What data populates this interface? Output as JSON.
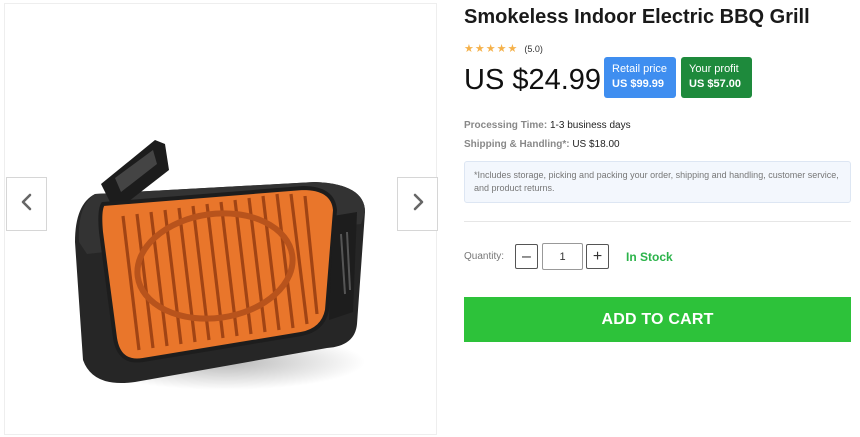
{
  "gallery": {
    "prev_icon": "chevron-left-icon",
    "next_icon": "chevron-right-icon",
    "image_alt": "Smokeless Indoor Electric BBQ Grill product image"
  },
  "product": {
    "title": "Smokeless Indoor Electric BBQ Grill",
    "rating_stars": 5,
    "rating_text": "(5.0)",
    "price": "US $24.99"
  },
  "badges": {
    "retail_label": "Retail price",
    "retail_value": "US $99.99",
    "profit_label": "Your profit",
    "profit_value": "US $57.00"
  },
  "info": {
    "processing_label": "Processing Time:",
    "processing_value": "1-3 business days",
    "shipping_label": "Shipping & Handling*:",
    "shipping_value": "US $18.00",
    "note": "*Includes storage, picking and packing your order, shipping and handling, customer service, and product returns."
  },
  "purchase": {
    "quantity_label": "Quantity:",
    "minus_label": "–",
    "plus_label": "+",
    "quantity_value": "1",
    "stock_status": "In Stock",
    "add_to_cart_label": "ADD TO CART"
  },
  "colors": {
    "retail_badge": "#3f8ef0",
    "profit_badge": "#1e8a3c",
    "cart_button": "#2dc23a",
    "in_stock": "#2bb34a",
    "star": "#f5b14a",
    "grill_plate": "#e9762b"
  }
}
